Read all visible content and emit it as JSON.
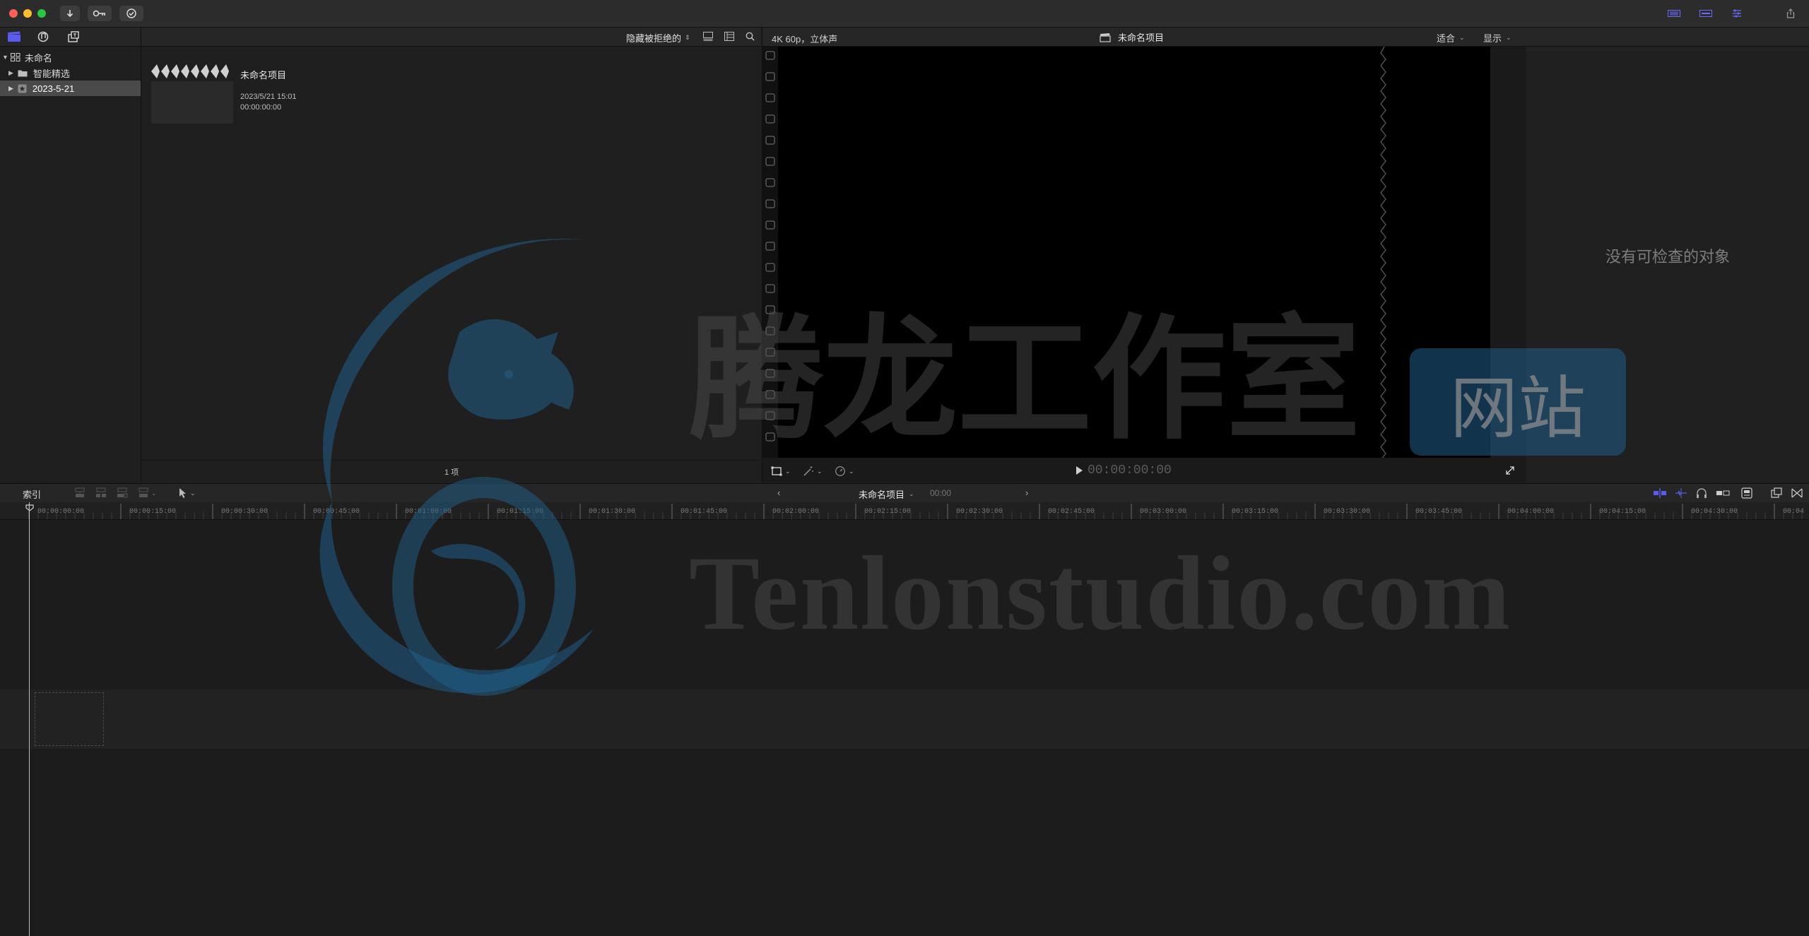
{
  "sidebar": {
    "library": "未命名",
    "items": [
      {
        "label": "智能精选"
      },
      {
        "label": "2023-5-21"
      }
    ]
  },
  "browser": {
    "filter_label": "隐藏被拒绝的",
    "clip": {
      "title": "未命名项目",
      "date": "2023/5/21 15:01",
      "duration": "00:00:00:00"
    },
    "item_count": "1 项"
  },
  "viewer": {
    "format": "4K 60p，立体声",
    "project_title": "未命名项目",
    "fit_label": "适合",
    "display_label": "显示",
    "timecode": "00:00:00:00"
  },
  "inspector": {
    "empty_text": "没有可检查的对象"
  },
  "timeline": {
    "index_label": "索引",
    "project_name": "未命名项目",
    "timecode": "00:00",
    "ruler": [
      "00:00:00:00",
      "00:00:15:00",
      "00:00:30:00",
      "00:00:45:00",
      "00:01:00:00",
      "00:01:15:00",
      "00:01:30:00",
      "00:01:45:00",
      "00:02:00:00",
      "00:02:15:00",
      "00:02:30:00",
      "00:02:45:00",
      "00:03:00:00",
      "00:03:15:00",
      "00:03:30:00",
      "00:03:45:00",
      "00:04:00:00",
      "00:04:15:00",
      "00:04:30:00",
      "00:04"
    ]
  },
  "watermark": {
    "cn": "腾龙工作室",
    "badge": "网站",
    "en": "Tenlonstudio.com"
  },
  "colors": {
    "accent": "#5a5cf0",
    "watermark_blue": "#1f5f8a"
  }
}
